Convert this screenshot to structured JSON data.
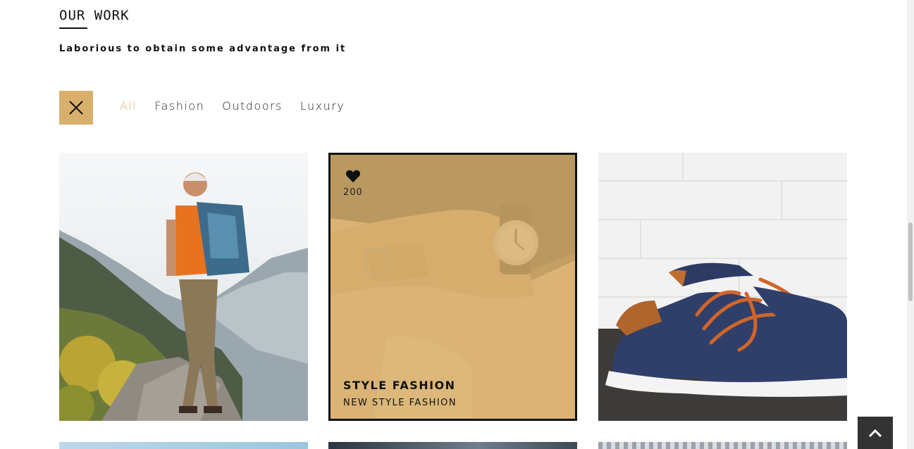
{
  "section": {
    "title": "OUR WORK",
    "subtitle": "Laborious to obtain some advantage from it"
  },
  "filters": {
    "toggle_icon": "close-icon",
    "items": [
      {
        "label": "All",
        "active": true
      },
      {
        "label": "Fashion",
        "active": false
      },
      {
        "label": "Outdoors",
        "active": false
      },
      {
        "label": "Luxury",
        "active": false
      }
    ]
  },
  "portfolio": {
    "cards": [
      {
        "image": "hiker-on-mountain-photo"
      },
      {
        "image": "hand-with-wristwatch-photo",
        "likes": "200",
        "title": "STYLE FASHION",
        "subtitle": "NEW STYLE FASHION"
      },
      {
        "image": "blue-sneakers-photo"
      }
    ]
  },
  "back_to_top_icon": "chevron-up-icon",
  "colors": {
    "accent": "#d8b06c",
    "dark": "#111111",
    "back_to_top_bg": "#333333"
  }
}
